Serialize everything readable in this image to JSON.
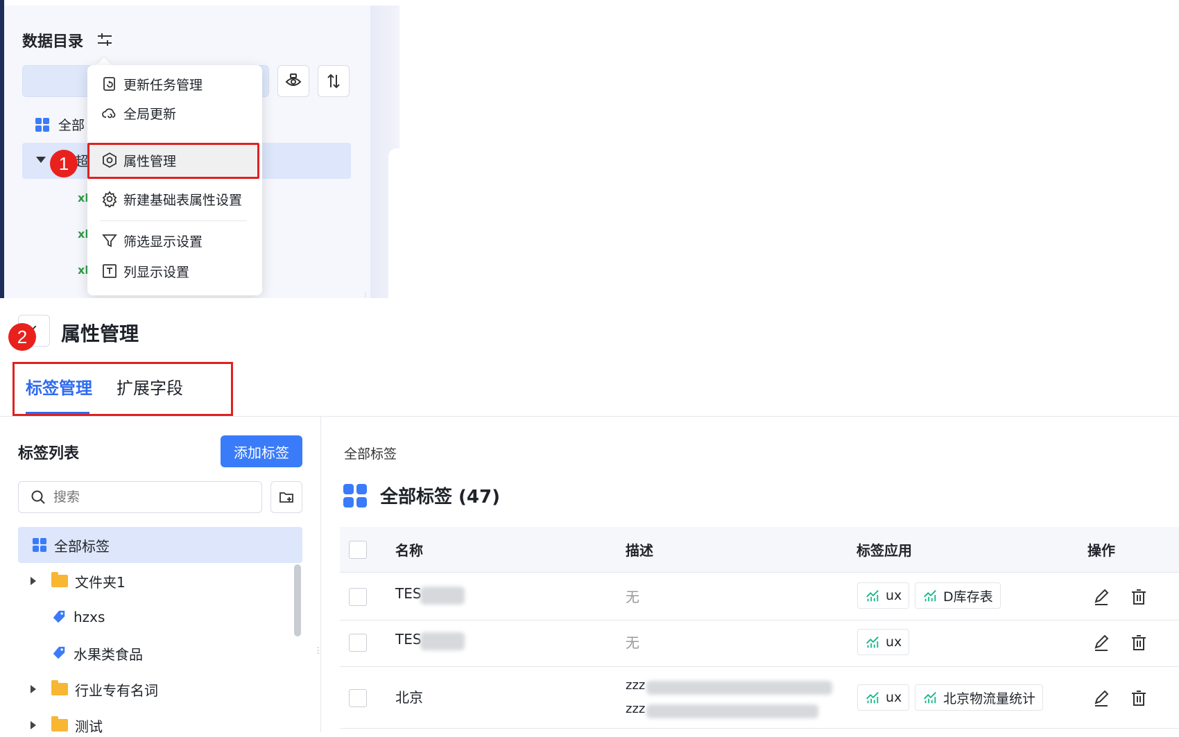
{
  "catalog": {
    "title": "数据目录",
    "all_label": "全部",
    "selected_label": "超",
    "file_prefix": "xl"
  },
  "menu": {
    "items": [
      {
        "label": "更新任务管理",
        "icon": "task-refresh-icon"
      },
      {
        "label": "全局更新",
        "icon": "cloud-refresh-icon"
      },
      {
        "label": "属性管理",
        "icon": "hexagon-settings-icon"
      },
      {
        "label": "新建基础表属性设置",
        "icon": "gear-icon"
      },
      {
        "label": "筛选显示设置",
        "icon": "filter-icon"
      },
      {
        "label": "列显示设置",
        "icon": "column-icon"
      }
    ]
  },
  "badges": {
    "one": "1",
    "two": "2"
  },
  "page": {
    "title": "属性管理",
    "tabs": [
      "标签管理",
      "扩展字段"
    ]
  },
  "tag_list": {
    "title": "标签列表",
    "add_button": "添加标签",
    "search_placeholder": "搜索",
    "all_tags": "全部标签",
    "tree": [
      {
        "label": "文件夹1",
        "type": "folder",
        "expandable": true
      },
      {
        "label": "hzxs",
        "type": "tag",
        "expandable": false
      },
      {
        "label": "水果类食品",
        "type": "tag",
        "expandable": false
      },
      {
        "label": "行业专有名词",
        "type": "folder",
        "expandable": true
      },
      {
        "label": "测试",
        "type": "folder",
        "expandable": true
      }
    ]
  },
  "tags_table": {
    "breadcrumb": "全部标签",
    "title": "全部标签 (47)",
    "columns": [
      "名称",
      "描述",
      "标签应用",
      "操作"
    ],
    "rows": [
      {
        "name": "TES",
        "desc": "无",
        "apps": [
          "ux",
          "D库存表"
        ]
      },
      {
        "name": "TES",
        "desc": "无",
        "apps": [
          "ux"
        ]
      },
      {
        "name": "北京",
        "desc": "zzz",
        "desc2": "zzz",
        "apps": [
          "ux",
          "北京物流量统计"
        ]
      }
    ]
  },
  "colors": {
    "primary": "#3a7bfa",
    "highlight_red": "#e02020",
    "chart_green": "#12b886",
    "folder_yellow": "#f7b733"
  }
}
